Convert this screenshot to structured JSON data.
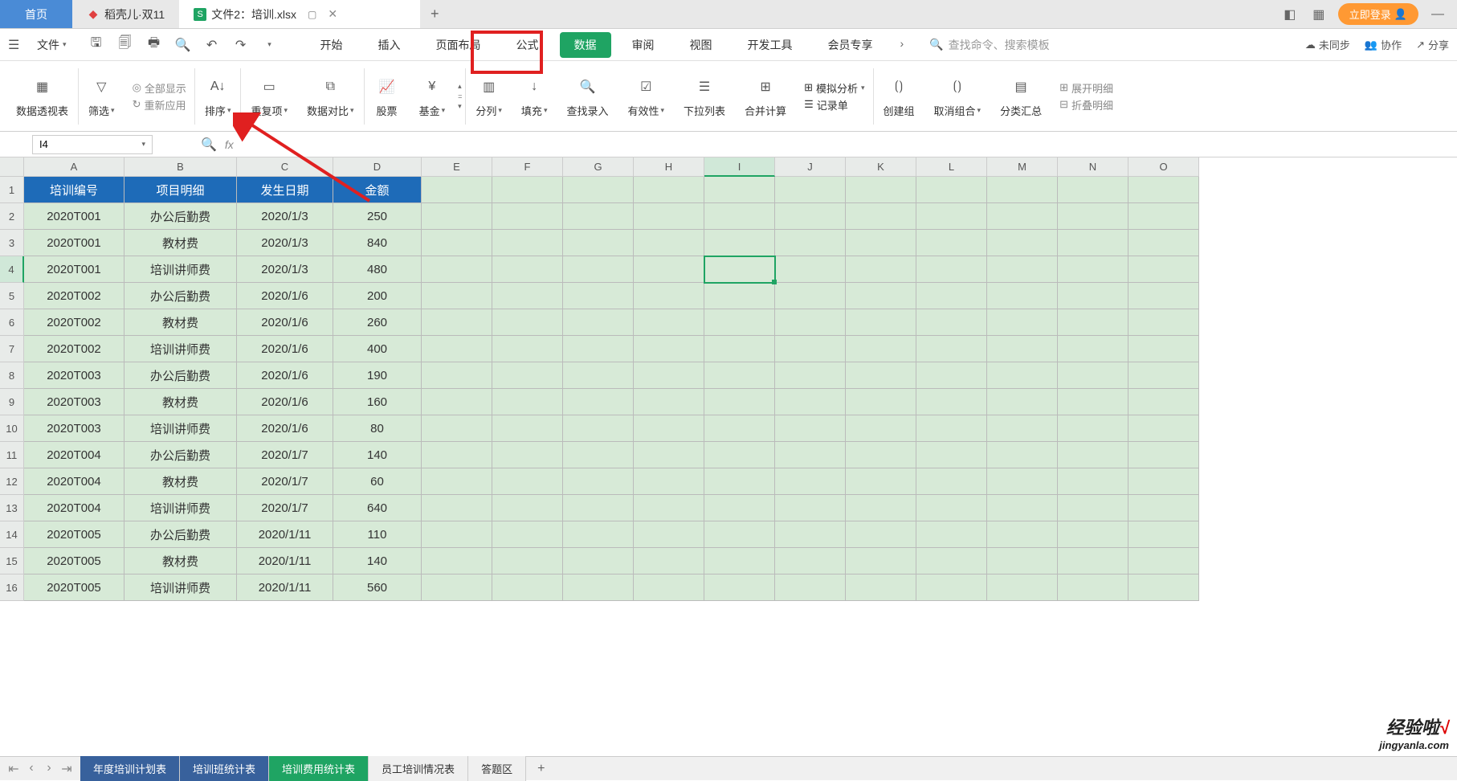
{
  "titlebar": {
    "home": "首页",
    "tab1": "稻壳儿·双11",
    "tab2_prefix": "文件2：",
    "tab2_name": "培训.xlsx",
    "login": "立即登录"
  },
  "menubar": {
    "file": "文件",
    "tabs": [
      "开始",
      "插入",
      "页面布局",
      "公式",
      "数据",
      "审阅",
      "视图",
      "开发工具",
      "会员专享"
    ],
    "active_tab": 4,
    "search_placeholder": "查找命令、搜索模板",
    "unsync": "未同步",
    "collab": "协作",
    "share": "分享"
  },
  "ribbon": {
    "pivot": "数据透视表",
    "filter": "筛选",
    "show_all": "全部显示",
    "reapply": "重新应用",
    "sort": "排序",
    "dedup": "重复项",
    "compare": "数据对比",
    "stock": "股票",
    "fund": "基金",
    "split": "分列",
    "fill": "填充",
    "find_entry": "查找录入",
    "validity": "有效性",
    "dropdown": "下拉列表",
    "consolidate": "合并计算",
    "simulate": "模拟分析",
    "record": "记录单",
    "group": "创建组",
    "ungroup": "取消组合",
    "subtotal": "分类汇总",
    "expand": "展开明细",
    "collapse": "折叠明细"
  },
  "formula_bar": {
    "cell_ref": "I4",
    "fx": "fx"
  },
  "sheet": {
    "columns": [
      "A",
      "B",
      "C",
      "D",
      "E",
      "F",
      "G",
      "H",
      "I",
      "J",
      "K",
      "L",
      "M",
      "N",
      "O"
    ],
    "selected_col": 8,
    "selected_row": 3,
    "headers": [
      "培训编号",
      "项目明细",
      "发生日期",
      "金额"
    ],
    "rows": [
      [
        "2020T001",
        "办公后勤费",
        "2020/1/3",
        "250"
      ],
      [
        "2020T001",
        "教材费",
        "2020/1/3",
        "840"
      ],
      [
        "2020T001",
        "培训讲师费",
        "2020/1/3",
        "480"
      ],
      [
        "2020T002",
        "办公后勤费",
        "2020/1/6",
        "200"
      ],
      [
        "2020T002",
        "教材费",
        "2020/1/6",
        "260"
      ],
      [
        "2020T002",
        "培训讲师费",
        "2020/1/6",
        "400"
      ],
      [
        "2020T003",
        "办公后勤费",
        "2020/1/6",
        "190"
      ],
      [
        "2020T003",
        "教材费",
        "2020/1/6",
        "160"
      ],
      [
        "2020T003",
        "培训讲师费",
        "2020/1/6",
        "80"
      ],
      [
        "2020T004",
        "办公后勤费",
        "2020/1/7",
        "140"
      ],
      [
        "2020T004",
        "教材费",
        "2020/1/7",
        "60"
      ],
      [
        "2020T004",
        "培训讲师费",
        "2020/1/7",
        "640"
      ],
      [
        "2020T005",
        "办公后勤费",
        "2020/1/11",
        "110"
      ],
      [
        "2020T005",
        "教材费",
        "2020/1/11",
        "140"
      ],
      [
        "2020T005",
        "培训讲师费",
        "2020/1/11",
        "560"
      ]
    ]
  },
  "sheet_tabs": {
    "tabs": [
      "年度培训计划表",
      "培训班统计表",
      "培训费用统计表",
      "员工培训情况表",
      "答题区"
    ],
    "active": 2
  },
  "watermark": {
    "line1": "经验啦",
    "check": "√",
    "line2": "jingyanla.com"
  }
}
